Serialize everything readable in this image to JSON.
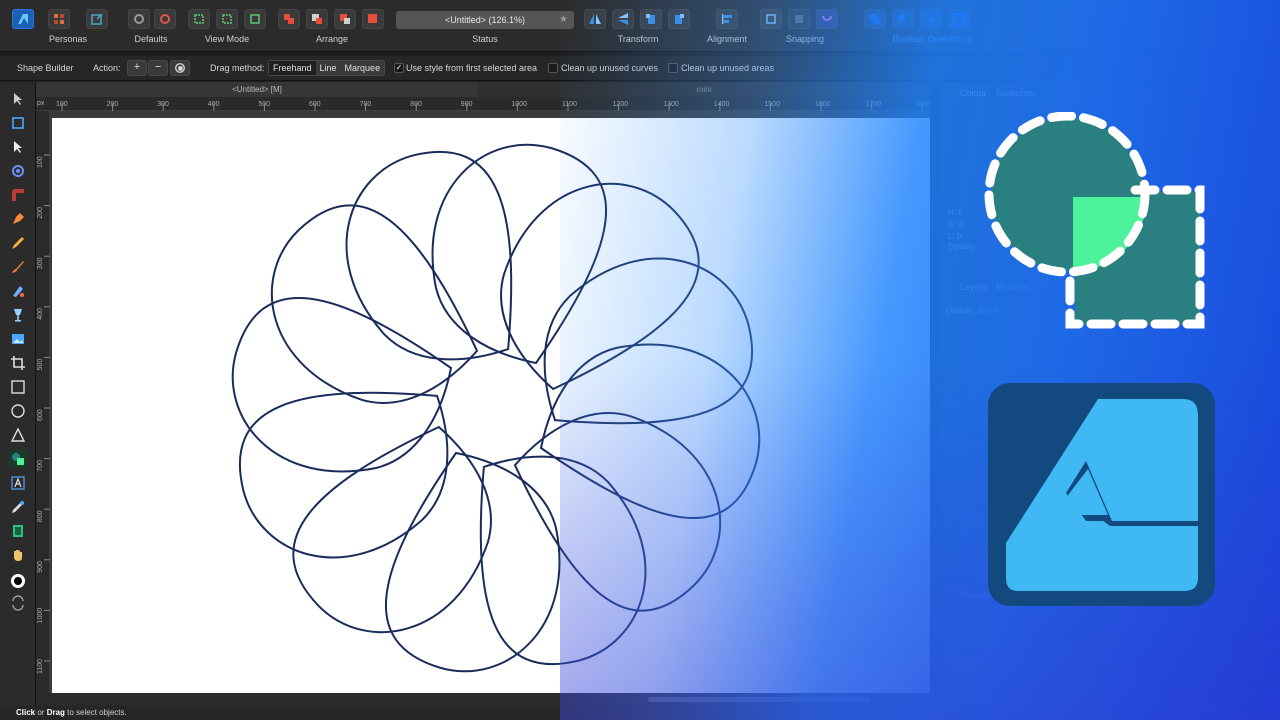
{
  "toolbar": {
    "personas_label": "Personas",
    "groups": [
      {
        "key": "defaults",
        "label": "Defaults"
      },
      {
        "key": "view_mode",
        "label": "View Mode"
      },
      {
        "key": "arrange",
        "label": "Arrange"
      },
      {
        "key": "status",
        "label": "Status"
      },
      {
        "key": "transform",
        "label": "Transform"
      },
      {
        "key": "alignment",
        "label": "Alignment"
      },
      {
        "key": "snapping",
        "label": "Snapping"
      },
      {
        "key": "boolean",
        "label": "Boolean Operations"
      }
    ],
    "status_text": "<Untitled> (126.1%)",
    "star": "★"
  },
  "context": {
    "tool_name": "Shape Builder",
    "action_label": "Action:",
    "plus": "+",
    "minus": "−",
    "drag_method_label": "Drag method:",
    "drag_methods": [
      "Freehand",
      "Line",
      "Marquee"
    ],
    "use_style_label": "Use style from first selected area",
    "use_style_checked": "✓",
    "clean_curves_label": "Clean up unused curves",
    "clean_areas_label": "Clean up unused areas"
  },
  "tabs": {
    "doc_tab": "<Untitled> [M]",
    "mini_tab": "mini"
  },
  "ruler": {
    "unit": "px",
    "h_ticks": [
      "100",
      "200",
      "300",
      "400",
      "500",
      "600",
      "700",
      "800",
      "900",
      "1000",
      "1100",
      "1200",
      "1300",
      "1400",
      "1500",
      "1600",
      "1700",
      "1800"
    ],
    "v_ticks": [
      "100",
      "200",
      "300",
      "400",
      "500",
      "600",
      "700",
      "800",
      "900",
      "1000",
      "1100"
    ]
  },
  "right_panel": {
    "colour_tab": "Colour",
    "swatches_tab": "Swatches",
    "h": "H: 0",
    "s": "S: 0",
    "l": "L: 0",
    "opacity_label": "Opacity",
    "layers_tab": "Layers",
    "brushes_tab": "Brushes",
    "layers_opacity": "Opacity: 100 %",
    "transform_tab": "Transform"
  },
  "statusbar": {
    "click": "Click",
    "or": " or ",
    "drag": "Drag",
    "rest": " to select objects."
  },
  "colors": {
    "accent_blue": "#1e6ff0",
    "shape_teal": "#2a8080",
    "shape_green": "#4cf39a",
    "logo_bg": "#124a80",
    "logo_fg": "#3fb8f4",
    "flower_stroke": "#1a2c5c"
  }
}
